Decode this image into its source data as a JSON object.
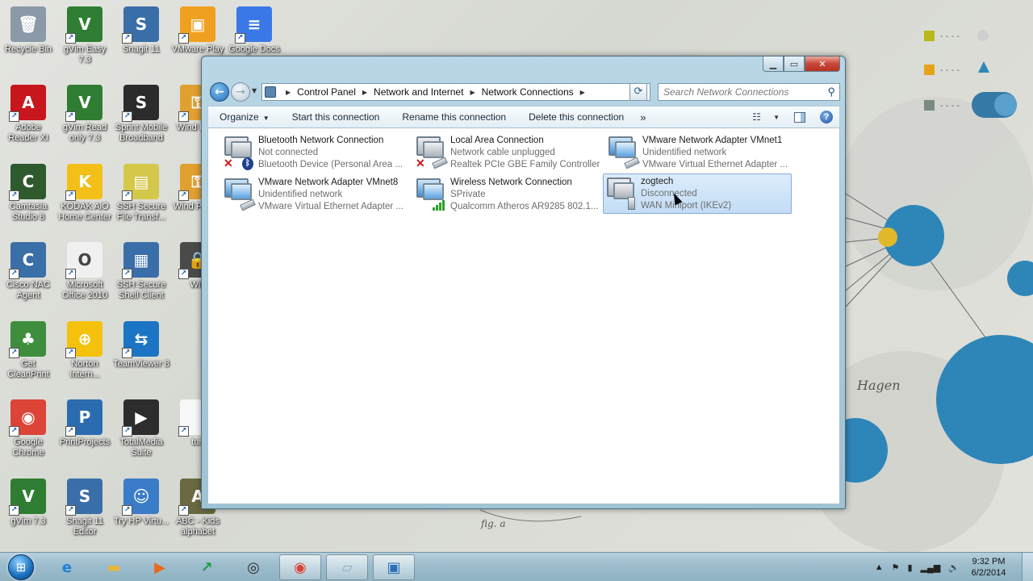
{
  "desktop": {
    "icons": [
      {
        "label": "Recycle Bin",
        "icon": "recycle-bin-icon",
        "color": "#8a9aa8",
        "glyph": "🗑"
      },
      {
        "label": "gVim Easy 7.3",
        "icon": "gvim-icon",
        "color": "#2f7d32",
        "glyph": "V"
      },
      {
        "label": "Snagit 11",
        "icon": "snagit-icon",
        "color": "#3a6ea8",
        "glyph": "S"
      },
      {
        "label": "VMware Play",
        "icon": "vmware-icon",
        "color": "#f0a020",
        "glyph": "▣"
      },
      {
        "label": "Google Docs",
        "icon": "google-docs-icon",
        "color": "#3b78e7",
        "glyph": "≡"
      },
      {
        "label": "Adobe Reader XI",
        "icon": "adobe-reader-icon",
        "color": "#c8161d",
        "glyph": "A"
      },
      {
        "label": "gVim Read only 7.3",
        "icon": "gvim-icon",
        "color": "#2f7d32",
        "glyph": "V"
      },
      {
        "label": "Sprint Mobile Broadband",
        "icon": "sprint-icon",
        "color": "#2b2b2b",
        "glyph": "S"
      },
      {
        "label": "Wind Pass",
        "icon": "key-icon",
        "color": "#e0a030",
        "glyph": "⚿"
      },
      {
        "label": "Camtasia Studio 8",
        "icon": "camtasia-icon",
        "color": "#2e5a2e",
        "glyph": "C"
      },
      {
        "label": "KODAK AiO Home Center",
        "icon": "kodak-icon",
        "color": "#f3c019",
        "glyph": "K"
      },
      {
        "label": "SSH Secure File Transf...",
        "icon": "ssh-file-icon",
        "color": "#d4c84a",
        "glyph": "▤"
      },
      {
        "label": "Wind Passw",
        "icon": "key-icon",
        "color": "#e0a030",
        "glyph": "⚿"
      },
      {
        "label": "Cisco NAC Agent",
        "icon": "cisco-icon",
        "color": "#3a6fa8",
        "glyph": "C"
      },
      {
        "label": "Microsoft Office 2010",
        "icon": "office-icon",
        "color": "#f0f0f0",
        "glyph": "O"
      },
      {
        "label": "SSH Secure Shell Client",
        "icon": "ssh-shell-icon",
        "color": "#3a6ea8",
        "glyph": "▦"
      },
      {
        "label": "Win",
        "icon": "lock-icon",
        "color": "#4a4a4a",
        "glyph": "🔒"
      },
      {
        "label": "Get CleanPrint",
        "icon": "cleanprint-icon",
        "color": "#3e8e3e",
        "glyph": "♣"
      },
      {
        "label": "Norton Intern...",
        "icon": "norton-icon",
        "color": "#f4c20d",
        "glyph": "⊕"
      },
      {
        "label": "TeamViewer 8",
        "icon": "teamviewer-icon",
        "color": "#1b74c4",
        "glyph": "⇆"
      },
      {
        "label": "Google Chrome",
        "icon": "chrome-icon",
        "color": "#db4437",
        "glyph": "◉"
      },
      {
        "label": "PrintProjects",
        "icon": "printprojects-icon",
        "color": "#2b6cb0",
        "glyph": "P"
      },
      {
        "label": "TotalMedia Suite",
        "icon": "totalmedia-icon",
        "color": "#2d2d2d",
        "glyph": "▶"
      },
      {
        "label": "tun",
        "icon": "document-icon",
        "color": "#f8f8f8",
        "glyph": " "
      },
      {
        "label": "gVim 7.3",
        "icon": "gvim-icon",
        "color": "#2f7d32",
        "glyph": "V"
      },
      {
        "label": "Snagit 11 Editor",
        "icon": "snagit-editor-icon",
        "color": "#3a6ea8",
        "glyph": "S"
      },
      {
        "label": "Try HP Virtu...",
        "icon": "hp-virtual-icon",
        "color": "#3a7cc8",
        "glyph": "☺"
      },
      {
        "label": "ABC - Kids alphabet",
        "icon": "abc-kids-icon",
        "color": "#6a6a40",
        "glyph": "A"
      }
    ]
  },
  "window": {
    "controls": {
      "minimize": "▁",
      "maximize": "▭",
      "close": "✕"
    },
    "address": {
      "crumbs": [
        "Control Panel",
        "Network and Internet",
        "Network Connections"
      ]
    },
    "search": {
      "placeholder": "Search Network Connections"
    },
    "toolbar": {
      "organize": "Organize",
      "start": "Start this connection",
      "rename": "Rename this connection",
      "delete": "Delete this connection",
      "more": "»"
    },
    "connections": [
      {
        "name": "Bluetooth Network Connection",
        "status": "Not connected",
        "device": "Bluetooth Device (Personal Area ..."
      },
      {
        "name": "Local Area Connection",
        "status": "Network cable unplugged",
        "device": "Realtek PCIe GBE Family Controller"
      },
      {
        "name": "VMware Network Adapter VMnet1",
        "status": "Unidentified network",
        "device": "VMware Virtual Ethernet Adapter ..."
      },
      {
        "name": "VMware Network Adapter VMnet8",
        "status": "Unidentified network",
        "device": "VMware Virtual Ethernet Adapter ..."
      },
      {
        "name": "Wireless Network Connection",
        "status": "SPrivate",
        "device": "Qualcomm Atheros AR9285 802.1..."
      },
      {
        "name": "zogtech",
        "status": "Disconnected",
        "device": "WAN Miniport (IKEv2)"
      }
    ]
  },
  "wallpaper": {
    "signature": "Hagen",
    "caption": "fig. a"
  },
  "taskbar": {
    "apps": [
      {
        "icon": "internet-explorer-icon",
        "glyph": "e",
        "color": "#1f7fd6"
      },
      {
        "icon": "file-explorer-icon",
        "glyph": "▬",
        "color": "#e5b840"
      },
      {
        "icon": "media-player-icon",
        "glyph": "▶",
        "color": "#e66a1c"
      },
      {
        "icon": "stocks-app-icon",
        "glyph": "↗",
        "color": "#1e9e45"
      },
      {
        "icon": "wireless-app-icon",
        "glyph": "◎",
        "color": "#2b2b2b"
      },
      {
        "icon": "chrome-icon",
        "glyph": "◉",
        "color": "#db4437"
      },
      {
        "icon": "notebook-app-icon",
        "glyph": "▱",
        "color": "#8aaec8"
      },
      {
        "icon": "network-connections-icon",
        "glyph": "▣",
        "color": "#2d6fb7"
      }
    ],
    "clock": {
      "time": "9:32 PM",
      "date": "6/2/2014"
    },
    "tray": {
      "arrow": "▲",
      "flag": "⚑",
      "battery": "▮",
      "signal": "▂▄▆",
      "volume": "🔊"
    }
  },
  "colors": {
    "accent": "#3399ff",
    "selection": "#c3dcf5",
    "wallpaper_blue": "#2e86b8"
  }
}
